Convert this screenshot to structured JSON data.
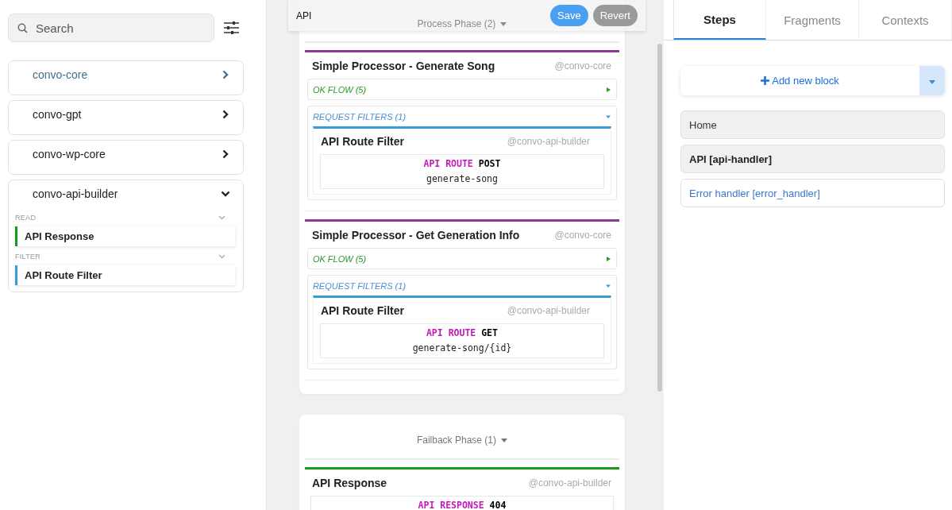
{
  "sidebar": {
    "search": {
      "placeholder": "Search"
    },
    "packages": [
      {
        "name": "convo-core",
        "selected": true,
        "expanded": false
      },
      {
        "name": "convo-gpt",
        "selected": false,
        "expanded": false
      },
      {
        "name": "convo-wp-core",
        "selected": false,
        "expanded": false
      },
      {
        "name": "convo-api-builder",
        "selected": false,
        "expanded": true,
        "sections": [
          {
            "label": "READ",
            "items": [
              {
                "name": "API Response",
                "color": "#1a9a1a"
              }
            ]
          },
          {
            "label": "FILTER",
            "items": [
              {
                "name": "API Route Filter",
                "color": "#3b9ad9"
              }
            ]
          }
        ]
      }
    ]
  },
  "editor": {
    "toolbar": {
      "title": "API",
      "save": "Save",
      "revert": "Revert"
    },
    "phases": [
      {
        "title": "Process Phase (2)",
        "blocks": [
          {
            "kind": "processor",
            "color": "#8e3a94",
            "title": "Simple Processor - Generate Song",
            "package": "@convo-core",
            "flows": [
              {
                "kind": "ok",
                "label": "OK FLOW (5)",
                "expanded": false
              },
              {
                "kind": "filters",
                "label": "REQUEST FILTERS (1)",
                "expanded": true,
                "children": [
                  {
                    "title": "API Route Filter",
                    "package": "@convo-api-builder",
                    "color": "#3b9ad9",
                    "keyword": "API ROUTE",
                    "value": "POST",
                    "detail": "generate-song"
                  }
                ]
              }
            ]
          },
          {
            "kind": "processor",
            "color": "#8e3a94",
            "title": "Simple Processor - Get Generation Info",
            "package": "@convo-core",
            "flows": [
              {
                "kind": "ok",
                "label": "OK FLOW (5)",
                "expanded": false
              },
              {
                "kind": "filters",
                "label": "REQUEST FILTERS (1)",
                "expanded": true,
                "children": [
                  {
                    "title": "API Route Filter",
                    "package": "@convo-api-builder",
                    "color": "#3b9ad9",
                    "keyword": "API ROUTE",
                    "value": "GET",
                    "detail": "generate-song/{id}"
                  }
                ]
              }
            ]
          }
        ]
      },
      {
        "title": "Failback Phase (1)",
        "blocks": [
          {
            "kind": "element",
            "color": "#1a9a1a",
            "title": "API Response",
            "package": "@convo-api-builder",
            "keyword": "API RESPONSE",
            "value": "404"
          }
        ]
      }
    ]
  },
  "panel": {
    "tabs": [
      {
        "label": "Steps",
        "selected": true
      },
      {
        "label": "Fragments",
        "selected": false
      },
      {
        "label": "Contexts",
        "selected": false
      }
    ],
    "add_button": "Add new block",
    "steps": [
      {
        "label": "Home",
        "kind": "plain",
        "selected": false
      },
      {
        "label": "API [api-handler]",
        "kind": "plain",
        "selected": true
      },
      {
        "label": "Error handler [error_handler]",
        "kind": "link",
        "selected": false
      }
    ]
  }
}
